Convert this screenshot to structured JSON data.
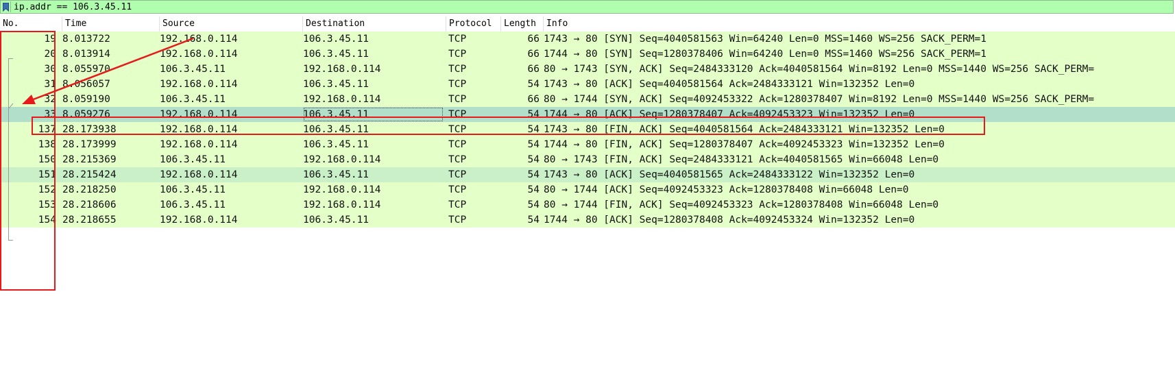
{
  "filter": {
    "value": "ip.addr == 106.3.45.11"
  },
  "columns": [
    "No.",
    "Time",
    "Source",
    "Destination",
    "Protocol",
    "Length",
    "Info"
  ],
  "packets": [
    {
      "no": "19",
      "time": "8.013722",
      "src": "192.168.0.114",
      "dst": "106.3.45.11",
      "proto": "TCP",
      "len": "66",
      "info": "1743 → 80 [SYN] Seq=4040581563 Win=64240 Len=0 MSS=1460 WS=256 SACK_PERM=1"
    },
    {
      "no": "20",
      "time": "8.013914",
      "src": "192.168.0.114",
      "dst": "106.3.45.11",
      "proto": "TCP",
      "len": "66",
      "info": "1744 → 80 [SYN] Seq=1280378406 Win=64240 Len=0 MSS=1460 WS=256 SACK_PERM=1"
    },
    {
      "no": "30",
      "time": "8.055970",
      "src": "106.3.45.11",
      "dst": "192.168.0.114",
      "proto": "TCP",
      "len": "66",
      "info": "80 → 1743 [SYN, ACK] Seq=2484333120 Ack=4040581564 Win=8192 Len=0 MSS=1440 WS=256 SACK_PERM="
    },
    {
      "no": "31",
      "time": "8.056057",
      "src": "192.168.0.114",
      "dst": "106.3.45.11",
      "proto": "TCP",
      "len": "54",
      "info": "1743 → 80 [ACK] Seq=4040581564 Ack=2484333121 Win=132352 Len=0"
    },
    {
      "no": "32",
      "time": "8.059190",
      "src": "106.3.45.11",
      "dst": "192.168.0.114",
      "proto": "TCP",
      "len": "66",
      "info": "80 → 1744 [SYN, ACK] Seq=4092453322 Ack=1280378407 Win=8192 Len=0 MSS=1440 WS=256 SACK_PERM="
    },
    {
      "no": "33",
      "time": "8.059276",
      "src": "192.168.0.114",
      "dst": "106.3.45.11",
      "proto": "TCP",
      "len": "54",
      "info": "1744 → 80 [ACK] Seq=1280378407 Ack=4092453323 Win=132352 Len=0"
    },
    {
      "no": "137",
      "time": "28.173938",
      "src": "192.168.0.114",
      "dst": "106.3.45.11",
      "proto": "TCP",
      "len": "54",
      "info": "1743 → 80 [FIN, ACK] Seq=4040581564 Ack=2484333121 Win=132352 Len=0"
    },
    {
      "no": "138",
      "time": "28.173999",
      "src": "192.168.0.114",
      "dst": "106.3.45.11",
      "proto": "TCP",
      "len": "54",
      "info": "1744 → 80 [FIN, ACK] Seq=1280378407 Ack=4092453323 Win=132352 Len=0"
    },
    {
      "no": "150",
      "time": "28.215369",
      "src": "106.3.45.11",
      "dst": "192.168.0.114",
      "proto": "TCP",
      "len": "54",
      "info": "80 → 1743 [FIN, ACK] Seq=2484333121 Ack=4040581565 Win=66048 Len=0"
    },
    {
      "no": "151",
      "time": "28.215424",
      "src": "192.168.0.114",
      "dst": "106.3.45.11",
      "proto": "TCP",
      "len": "54",
      "info": "1743 → 80 [ACK] Seq=4040581565 Ack=2484333122 Win=132352 Len=0"
    },
    {
      "no": "152",
      "time": "28.218250",
      "src": "106.3.45.11",
      "dst": "192.168.0.114",
      "proto": "TCP",
      "len": "54",
      "info": "80 → 1744 [ACK] Seq=4092453323 Ack=1280378408 Win=66048 Len=0"
    },
    {
      "no": "153",
      "time": "28.218606",
      "src": "106.3.45.11",
      "dst": "192.168.0.114",
      "proto": "TCP",
      "len": "54",
      "info": "80 → 1744 [FIN, ACK] Seq=4092453323 Ack=1280378408 Win=66048 Len=0"
    },
    {
      "no": "154",
      "time": "28.218655",
      "src": "192.168.0.114",
      "dst": "106.3.45.11",
      "proto": "TCP",
      "len": "54",
      "info": "1744 → 80 [ACK] Seq=1280378408 Ack=4092453324 Win=132352 Len=0"
    }
  ],
  "colors": {
    "filter_valid": "#afffaf",
    "tcp_row": "#e4ffc7",
    "alt_row": "#c9f0c7",
    "selected_row": "#b2dfc9",
    "annotation": "#e8191b"
  },
  "icons": {
    "filter_bookmark": "bookmark-icon"
  }
}
